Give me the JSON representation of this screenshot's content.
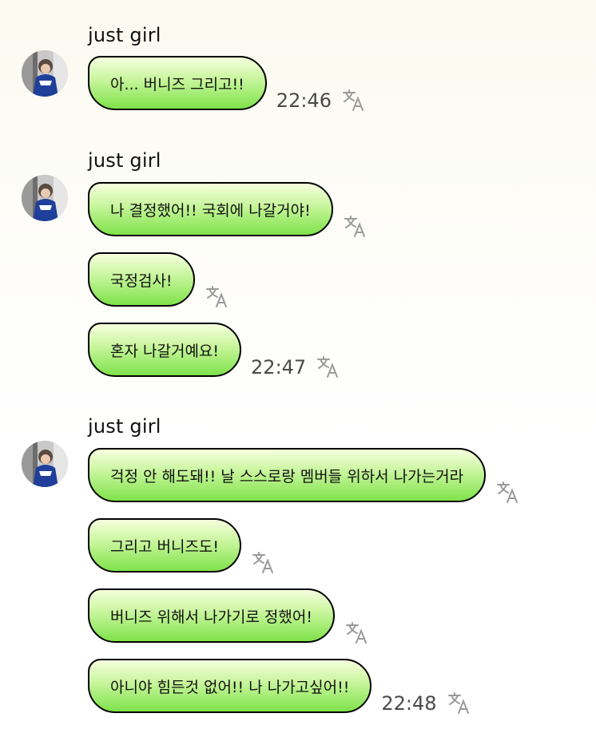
{
  "groups": [
    {
      "sender": "just girl",
      "messages": [
        {
          "text": "아... 버니즈 그리고!!",
          "time": "22:46"
        }
      ]
    },
    {
      "sender": "just girl",
      "messages": [
        {
          "text": "나 결정했어!! 국회에 나갈거야!",
          "time": ""
        },
        {
          "text": "국정검사!",
          "time": ""
        },
        {
          "text": "혼자 나갈거예요!",
          "time": "22:47"
        }
      ]
    },
    {
      "sender": "just girl",
      "messages": [
        {
          "text": "걱정 안 해도돼!! 날 스스로랑 멤버들 위하서 나가는거라",
          "time": ""
        },
        {
          "text": "그리고 버니즈도!",
          "time": ""
        },
        {
          "text": "버니즈 위해서 나가기로 정했어!",
          "time": ""
        },
        {
          "text": "아니야 힘든것 없어!! 나 나가고싶어!!",
          "time": "22:48"
        }
      ]
    }
  ],
  "icons": {
    "translate": "translate-icon",
    "avatar": "avatar-photo"
  },
  "colors": {
    "bubble_top": "#f6ffde",
    "bubble_bottom": "#7fe24a",
    "bubble_border": "#000000",
    "timestamp": "#4a4a4a",
    "icon": "#9a9a9a"
  }
}
